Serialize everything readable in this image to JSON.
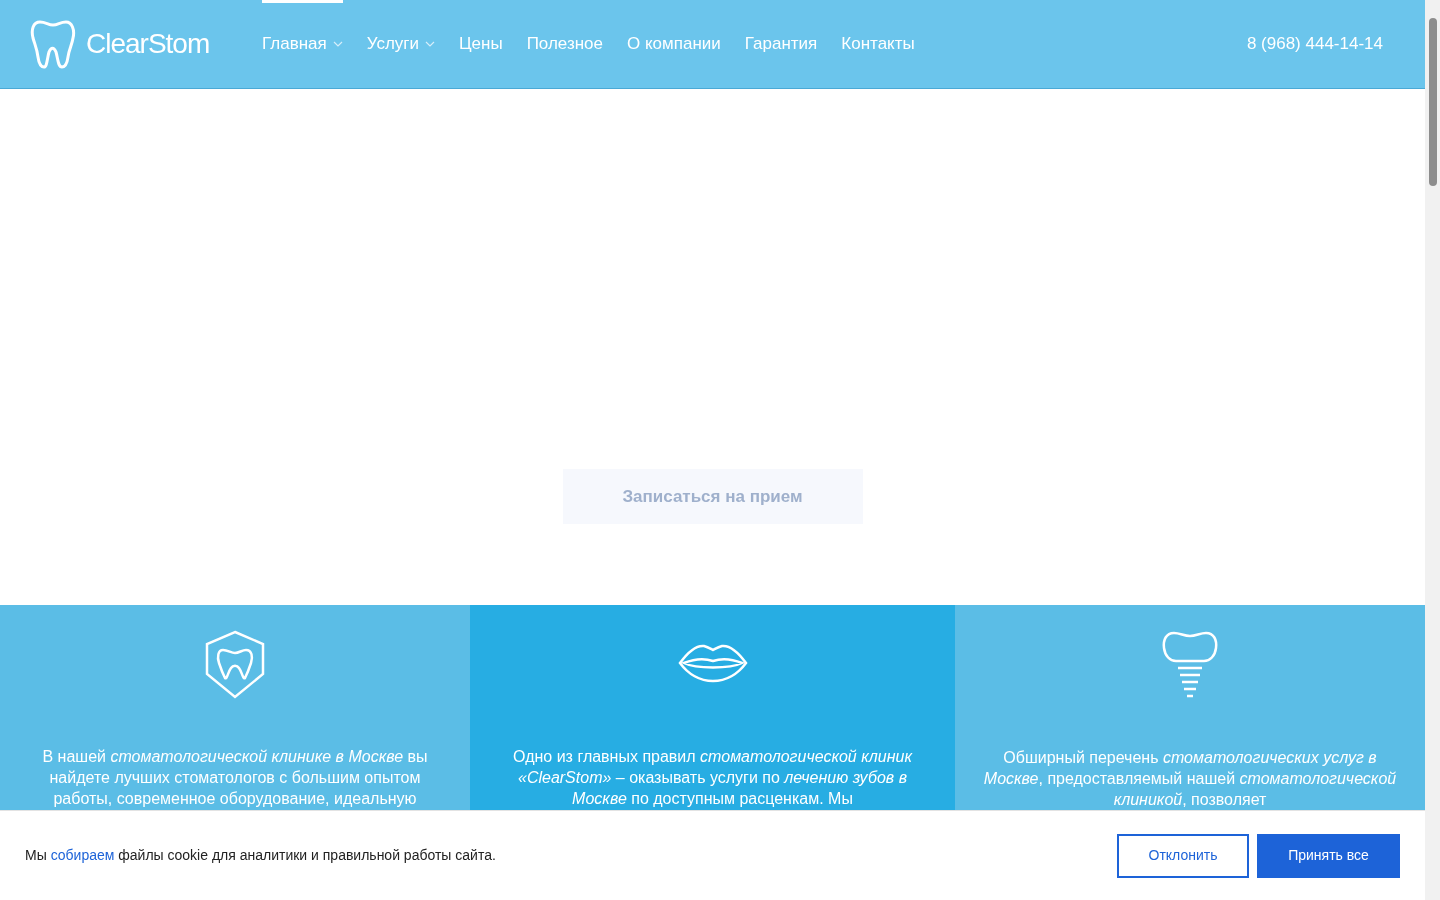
{
  "header": {
    "logo": "ClearStom",
    "phone": "8 (968) 444-14-14",
    "nav": [
      {
        "label": "Главная",
        "selected": true,
        "dropdown": true
      },
      {
        "label": "Услуги",
        "selected": false,
        "dropdown": true
      },
      {
        "label": "Цены",
        "selected": false,
        "dropdown": false
      },
      {
        "label": "Полезное",
        "selected": false,
        "dropdown": false
      },
      {
        "label": "О компании",
        "selected": false,
        "dropdown": false
      },
      {
        "label": "Гарантия",
        "selected": false,
        "dropdown": false
      },
      {
        "label": "Контакты",
        "selected": false,
        "dropdown": false
      }
    ]
  },
  "hero": {
    "button": "Записаться на прием"
  },
  "features": [
    {
      "kind": "shield-tooth",
      "highlight": false,
      "text": "В нашей *стоматологической клинике в Москве* вы найдете лучших стоматологов с большим опытом работы, современное оборудование, идеальную"
    },
    {
      "kind": "lips",
      "highlight": true,
      "text": "Одно из главных правил *стоматологической клиник «ClearStom»* – оказывать услуги по *лечению зубов в Москве* по доступным расценкам. Мы"
    },
    {
      "kind": "implant",
      "highlight": false,
      "text": "Обширный перечень *стоматологических услуг в Москве*, предоставляемый нашей *стоматологической клиникой*, позволяет"
    }
  ],
  "cookie_banner": {
    "text_before": "Мы",
    "link": "собираем",
    "text_after": "файлы cookie для аналитики и правильной работы сайта.",
    "decline": "Отклонить",
    "accept": "Принять все"
  }
}
